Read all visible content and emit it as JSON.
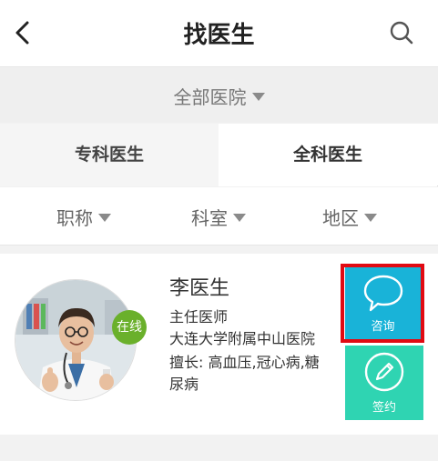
{
  "header": {
    "title": "找医生"
  },
  "hospital_filter": {
    "label": "全部医院"
  },
  "tabs": [
    {
      "label": "专科医生",
      "active": false
    },
    {
      "label": "全科医生",
      "active": true
    }
  ],
  "filters": [
    {
      "label": "职称"
    },
    {
      "label": "科室"
    },
    {
      "label": "地区"
    }
  ],
  "doctor": {
    "name": "李医生",
    "title": "主任医师",
    "hospital": "大连大学附属中山医院",
    "specialty": "擅长: 高血压,冠心病,糖尿病",
    "status": "在线"
  },
  "actions": {
    "consult_label": "咨询",
    "sign_label": "签约"
  },
  "colors": {
    "consult": "#19b3d8",
    "sign": "#2fd4b2",
    "online": "#6ab02b",
    "highlight": "#e10a12"
  }
}
